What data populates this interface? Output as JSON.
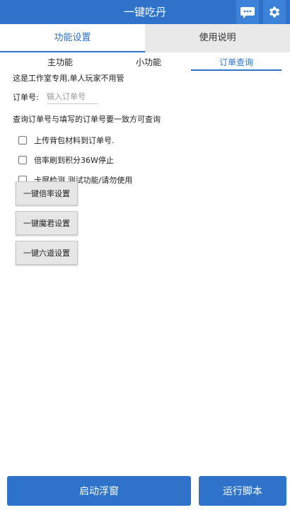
{
  "app": {
    "title": "一键吃丹",
    "header_icons": [
      "chat-icon",
      "gear-icon"
    ]
  },
  "main_tabs": [
    {
      "label": "功能设置",
      "active": true
    },
    {
      "label": "使用说明",
      "active": false
    }
  ],
  "sub_tabs": [
    {
      "label": "主功能",
      "active": false
    },
    {
      "label": "小功能",
      "active": false
    },
    {
      "label": "订单查询",
      "active": true
    }
  ],
  "notice": "这是工作室专用,单人玩家不用管",
  "order": {
    "label": "订单号:",
    "placeholder": "输入订单号",
    "value": ""
  },
  "hint": "查询订单号与填写的订单号要一致方可查询",
  "checkboxes": [
    {
      "label": "上传背包材料到订单号.",
      "checked": false
    },
    {
      "label": "倍率刷到积分36W停止",
      "checked": false
    },
    {
      "label": "卡屏检测,测试功能/请勿使用",
      "checked": false
    }
  ],
  "action_buttons": [
    {
      "label": "一键倍率设置"
    },
    {
      "label": "一键魔君设置"
    },
    {
      "label": "一键六道设置"
    }
  ],
  "bottom": {
    "float_label": "启动浮窗",
    "run_label": "运行脚本"
  },
  "colors": {
    "accent": "#2e73c9",
    "inactive_tab_bg": "#e9e9e9",
    "button_bg": "#e6e6e6"
  }
}
